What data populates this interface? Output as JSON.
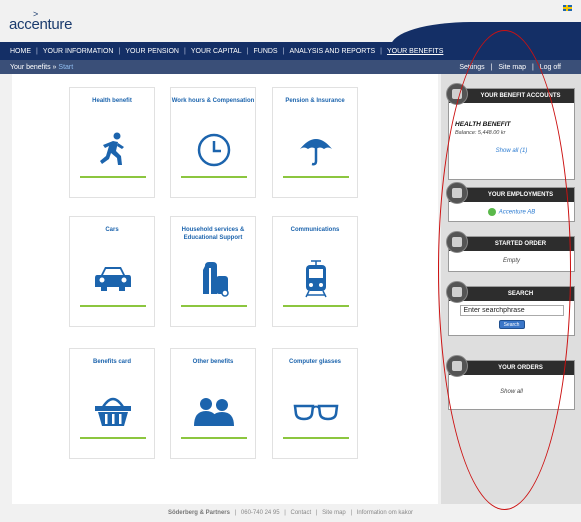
{
  "header": {
    "logo_text": "accenture",
    "logo_caret": ">"
  },
  "nav": {
    "items": [
      {
        "label": "HOME"
      },
      {
        "label": "YOUR INFORMATION"
      },
      {
        "label": "YOUR PENSION"
      },
      {
        "label": "YOUR CAPITAL"
      },
      {
        "label": "FUNDS"
      },
      {
        "label": "ANALYSIS AND REPORTS"
      },
      {
        "label": "YOUR BENEFITS"
      }
    ],
    "separator": "|"
  },
  "subbar": {
    "breadcrumb_prefix": "Your benefits »",
    "breadcrumb_link": "Start",
    "settings": "Settings",
    "sitemap": "Site map",
    "logoff": "Log off",
    "separator": "|"
  },
  "tiles": [
    {
      "title": "Health benefit",
      "icon": "runner-icon"
    },
    {
      "title": "Work hours & Compensation",
      "icon": "clock-icon"
    },
    {
      "title": "Pension & Insurance",
      "icon": "umbrella-icon"
    },
    {
      "title": "Cars",
      "icon": "car-icon"
    },
    {
      "title": "Household services & Educational Support",
      "icon": "vacuum-cleaner-icon"
    },
    {
      "title": "Communications",
      "icon": "train-icon"
    },
    {
      "title": "Benefits card",
      "icon": "basket-icon"
    },
    {
      "title": "Other benefits",
      "icon": "people-icon"
    },
    {
      "title": "Computer glasses",
      "icon": "glasses-icon"
    }
  ],
  "sidebar": {
    "accounts": {
      "title": "YOUR BENEFIT ACCOUNTS",
      "account_name": "HEALTH BENEFIT",
      "balance": "Balance: 5,448.00 kr",
      "show_all": "Show all (1)"
    },
    "employments": {
      "title": "YOUR EMPLOYMENTS",
      "employer": "Accenture AB"
    },
    "order": {
      "title": "STARTED ORDER",
      "status": "Empty"
    },
    "search": {
      "title": "SEARCH",
      "placeholder": "Enter searchphrase",
      "button": "Search"
    },
    "orders": {
      "title": "YOUR ORDERS",
      "show_all": "Show all"
    }
  },
  "footer": {
    "company": "Söderberg & Partners",
    "phone": "060-740 24 95",
    "contact": "Contact",
    "sitemap": "Site map",
    "cookies": "Information om kakor",
    "separator": "|"
  },
  "colors": {
    "nav_bg": "#142f66",
    "accent_blue": "#1c64ad",
    "green_line": "#8cc63f",
    "annotation_red": "#cc1111"
  }
}
